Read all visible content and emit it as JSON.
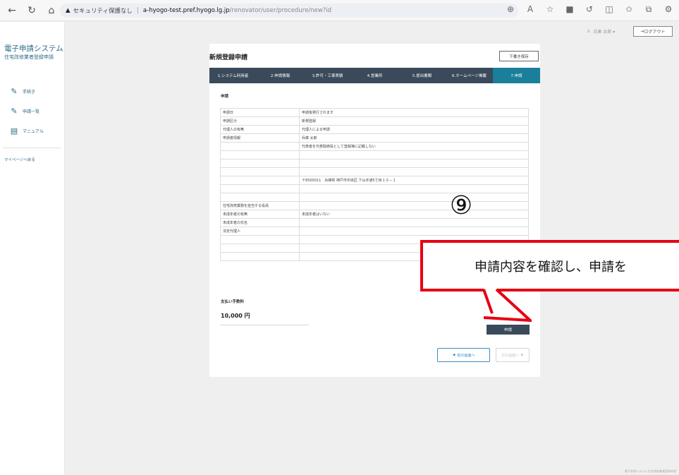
{
  "browser": {
    "security_label": "セキュリティ保護なし",
    "host": "a-hyogo-test.pref.hyogo.lg.jp",
    "path": "/renovator/user/procedure/new?id"
  },
  "sidebar": {
    "brand_title": "電子申請システム",
    "brand_subtitle": "住宅改修業者登録申請",
    "items": [
      {
        "label": "手続き"
      },
      {
        "label": "申請一覧"
      },
      {
        "label": "マニュアル"
      }
    ],
    "mypage_link": "マイページへ戻る"
  },
  "header": {
    "user_name": "兵庫 太郎 ▾",
    "logout_label": "ログアウト"
  },
  "page": {
    "title": "新規登録申請",
    "draft_button": "下書き保存",
    "steps": [
      {
        "label": "1.システム利用者"
      },
      {
        "label": "2.申請情報"
      },
      {
        "label": "3.許可・工事実績"
      },
      {
        "label": "4.営業所"
      },
      {
        "label": "5.提出書類"
      },
      {
        "label": "6.ホームページ掲載"
      },
      {
        "label": "7.申請"
      }
    ],
    "active_step": 6,
    "section_label": "申請",
    "table_rows": [
      {
        "label": "申請日",
        "value": "申請後発行されます"
      },
      {
        "label": "申請区分",
        "value": "新規登録"
      },
      {
        "label": "代理人の有無",
        "value": "代理人による申請"
      },
      {
        "label": "申請者情報",
        "value": "兵庫 太郎"
      },
      {
        "label": "",
        "value": "代表者を代表取締役として登録簿に記載しない"
      },
      {
        "label": "",
        "value": ""
      },
      {
        "label": "",
        "value": ""
      },
      {
        "label": "",
        "value": ""
      },
      {
        "label": "",
        "value": "〒6500011　兵庫県 神戸市中央区 下山手通5丁目１０－１"
      },
      {
        "label": "",
        "value": ""
      },
      {
        "label": "",
        "value": ""
      },
      {
        "label": "住宅改修業務を担当する役員",
        "value": ""
      },
      {
        "label": "未成年者の有無",
        "value": "未成年者はいない"
      },
      {
        "label": "未成年者の氏名",
        "value": ""
      },
      {
        "label": "法定代理人",
        "value": ""
      },
      {
        "label": "",
        "value": ""
      },
      {
        "label": "",
        "value": ""
      },
      {
        "label": "",
        "value": ""
      }
    ],
    "fee_label": "支払い手数料",
    "fee_value": "10,000 円",
    "apply_button": "申請",
    "prev_button": "前の画面へ",
    "next_button": "次の画面へ"
  },
  "annotation": {
    "number": "⑨",
    "callout_text": "申請内容を確認し、申請を",
    "color": "#e60012"
  },
  "footer": {
    "text": "電子申請システム 住宅改修業者登録申請"
  }
}
